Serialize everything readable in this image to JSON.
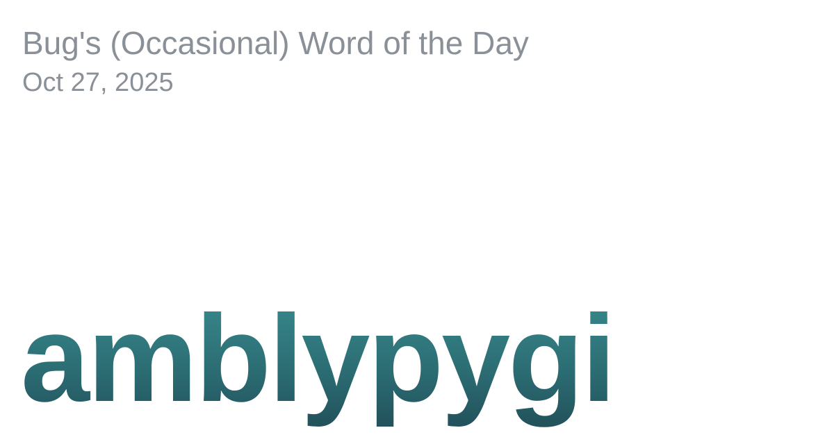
{
  "header": {
    "title": "Bug's (Occasional) Word of the Day",
    "date": "Oct 27, 2025"
  },
  "main": {
    "word": "amblypygi"
  },
  "colors": {
    "meta_text": "#8a9097",
    "word_gradient_top": "#3a8c90",
    "word_gradient_bottom": "#22505a",
    "background": "#ffffff"
  }
}
